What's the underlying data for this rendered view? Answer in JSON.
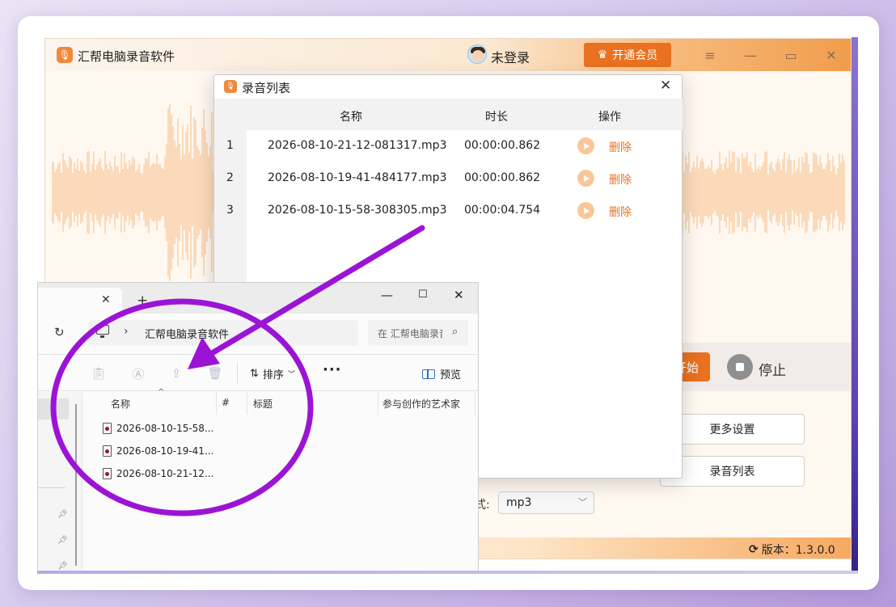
{
  "app": {
    "title": "汇帮电脑录音软件",
    "user_label": "未登录",
    "vip_button": "开通会员",
    "start_button": "开始",
    "stop_label": "停止",
    "more_settings": "更多设置",
    "recording_list": "录音列表",
    "format_label": "式:",
    "format_value": "mp3",
    "version_label": "版本：1.3.0.0"
  },
  "dialog": {
    "title": "录音列表",
    "columns": [
      "名称",
      "时长",
      "操作"
    ],
    "rows": [
      {
        "index": "1",
        "name": "2026-08-10-21-12-081317.mp3",
        "duration": "00:00:00.862",
        "action": "删除"
      },
      {
        "index": "2",
        "name": "2026-08-10-19-41-484177.mp3",
        "duration": "00:00:00.862",
        "action": "删除"
      },
      {
        "index": "3",
        "name": "2026-08-10-15-58-308305.mp3",
        "duration": "00:00:04.754",
        "action": "删除"
      }
    ]
  },
  "explorer": {
    "new_tab": "+",
    "path": "汇帮电脑录音软件",
    "search_placeholder": "在 汇帮电脑录音软件 中搜索",
    "sort_label": "排序",
    "more_label": "···",
    "preview_label": "预览",
    "columns": [
      "名称",
      "#",
      "标题",
      "参与创作的艺术家"
    ],
    "files": [
      "2026-08-10-15-58...",
      "2026-08-10-19-41...",
      "2026-08-10-21-12..."
    ]
  },
  "colors": {
    "accent": "#e9711f",
    "wave": "#f9c797",
    "annotation": "#9b14d6"
  }
}
